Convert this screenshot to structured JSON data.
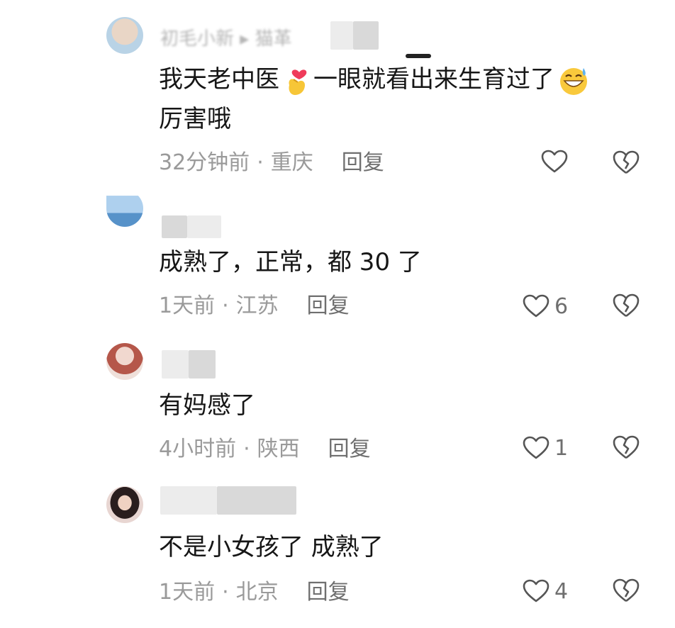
{
  "comments": [
    {
      "username": "初毛小新 ▸ 猫革",
      "text_before_emoji": "我天老中医",
      "text_after_emoji": "一眼就看出来生育过了",
      "text_line2": "厉害哦",
      "time": "32分钟前",
      "location": "重庆",
      "reply": "回复",
      "likes": ""
    },
    {
      "username": "",
      "text": "成熟了，正常，都 30 了",
      "time": "1天前",
      "location": "江苏",
      "reply": "回复",
      "likes": "6"
    },
    {
      "username": "",
      "text": "有妈感了",
      "time": "4小时前",
      "location": "陕西",
      "reply": "回复",
      "likes": "1"
    },
    {
      "username": "",
      "text": "不是小女孩了 成熟了",
      "time": "1天前",
      "location": "北京",
      "reply": "回复",
      "likes": "4"
    }
  ],
  "separator": "·",
  "icons": {
    "like": "heart-outline-icon",
    "dislike": "broken-heart-icon",
    "emoji1": "finger-heart-emoji",
    "emoji2": "grinning-sweat-emoji"
  }
}
